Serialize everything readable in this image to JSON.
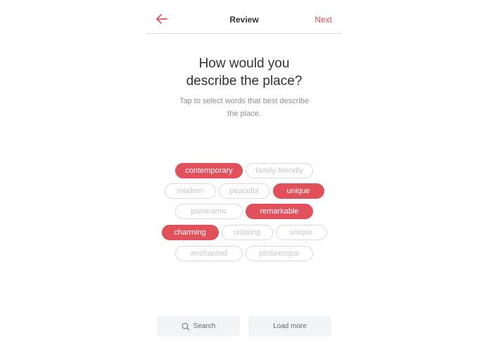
{
  "header": {
    "title": "Review",
    "next_label": "Next",
    "back_icon": "arrow-left-icon"
  },
  "question": {
    "line1": "How would you",
    "line2": "describe the place?"
  },
  "subtitle": {
    "line1": "Tap to select words that best describe",
    "line2": "the place."
  },
  "tags": {
    "rows": [
      [
        {
          "label": "contemporary",
          "selected": true
        },
        {
          "label": "family-friendly",
          "selected": false
        }
      ],
      [
        {
          "label": "modern",
          "selected": false
        },
        {
          "label": "peaceful",
          "selected": false
        },
        {
          "label": "unique",
          "selected": true
        }
      ],
      [
        {
          "label": "panoramic",
          "selected": false
        },
        {
          "label": "remarkable",
          "selected": true
        }
      ],
      [
        {
          "label": "charming",
          "selected": true
        },
        {
          "label": "relaxing",
          "selected": false
        },
        {
          "label": "unique",
          "selected": false
        }
      ],
      [
        {
          "label": "enchanted",
          "selected": false
        },
        {
          "label": "picturesque",
          "selected": false
        }
      ]
    ]
  },
  "buttons": {
    "search_label": "Search",
    "load_more_label": "Load more"
  },
  "colors": {
    "accent": "#e0515c",
    "text": "#333333",
    "muted": "#8f8f8f",
    "tag_border": "#d8d8d8",
    "button_bg": "#f3f4f6"
  }
}
